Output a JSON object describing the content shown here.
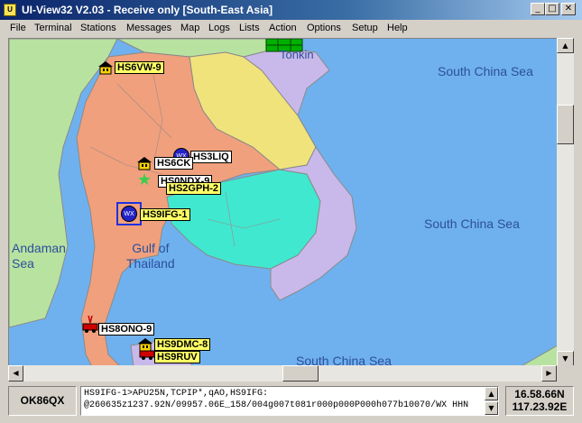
{
  "window": {
    "title": "UI-View32 V2.03 - Receive only [South-East Asia]"
  },
  "menu": [
    "File",
    "Terminal",
    "Stations",
    "Messages",
    "Map",
    "Logs",
    "Lists",
    "Action",
    "Options",
    "Setup",
    "Help"
  ],
  "map": {
    "place_labels": {
      "tonkin": "Tonkin",
      "scs1": "South China Sea",
      "scs2": "South China Sea",
      "scs3": "South China Sea",
      "andaman": "Andaman\nSea",
      "gulf": "Gulf of\nThailand"
    },
    "stations": [
      {
        "call": "HS6VW-9",
        "icon": "house-icon",
        "highlight": true
      },
      {
        "call": "HS3LIQ",
        "icon": "wx-icon",
        "highlight": false
      },
      {
        "call": "HS6CK",
        "icon": "house-icon",
        "highlight": false
      },
      {
        "call": "HS0NDX-9",
        "icon": "",
        "highlight": false
      },
      {
        "call": "HS2GPH-2",
        "icon": "star-icon",
        "highlight": true
      },
      {
        "call": "HS9IFG-1",
        "icon": "wx-icon",
        "highlight": true
      },
      {
        "call": "HS8ONO-9",
        "icon": "car-icon",
        "highlight": false
      },
      {
        "call": "HS9DMC-8",
        "icon": "house-icon",
        "highlight": true
      },
      {
        "call": "HS9RUV",
        "icon": "car-icon",
        "highlight": true
      }
    ],
    "colors": {
      "sea": "#6fb1ee",
      "thailand": "#f0a07c",
      "laos": "#f0e37c",
      "cambodia": "#40e8d0",
      "vietnam": "#c9b9ea",
      "myanmar": "#b8e2a0"
    }
  },
  "status": {
    "callsign": "OK86QX",
    "packet_line1": "HS9IFG-1>APU25N,TCPIP*,qAO,HS9IFG:",
    "packet_line2": "@260635z1237.92N/09957.06E_158/004g007t081r000p000P000h077b10070/WX HHN",
    "latitude": "16.58.66N",
    "longitude": "117.23.92E"
  }
}
